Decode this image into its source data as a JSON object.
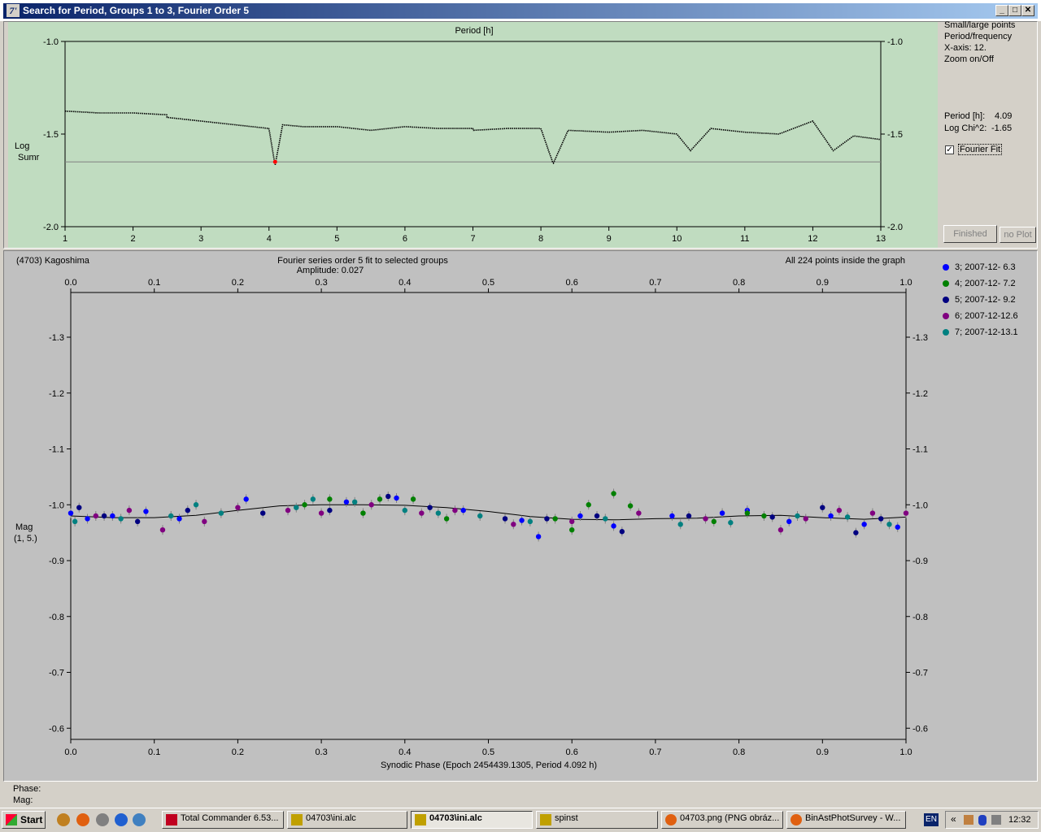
{
  "window": {
    "title": "Search for Period, Groups 1 to 3, Fourier Order 5",
    "app_icon": "7'",
    "controls": [
      "minimize",
      "maximize",
      "close"
    ]
  },
  "period_panel": {
    "options": [
      "Small/large points",
      "Period/frequency",
      "X-axis: 12.",
      "Zoom on/Off"
    ],
    "period_label": "Period [h]:",
    "period_value": "4.09",
    "chi_label": "Log Chi^2:",
    "chi_value": "-1.65",
    "fourier_fit_label": "Fourier Fit",
    "fourier_fit_checked": true,
    "finished_label": "Finished",
    "noplot_label": "no Plot"
  },
  "period_chart": {
    "title": "Period [h]",
    "ylabel_1": "Log",
    "ylabel_2": "Sumr",
    "x_ticks": [
      "1",
      "2",
      "3",
      "4",
      "5",
      "6",
      "7",
      "8",
      "9",
      "10",
      "11",
      "12",
      "13"
    ],
    "y_ticks_left": [
      "-1.0",
      "-1.5",
      "-2.0"
    ],
    "y_ticks_right": [
      "-1.0",
      "-1.5",
      "-2.0"
    ],
    "bg_color": "#c0dcc0"
  },
  "phase_panel": {
    "object": "(4703) Kagoshima",
    "fit_title": "Fourier series order 5 fit to selected groups",
    "amplitude": "Amplitude: 0.027",
    "points_info": "All 224 points inside the graph",
    "ylabel_1": "Mag",
    "ylabel_2": "(1, 5.)",
    "xlabel": "Synodic Phase (Epoch 2454439.1305, Period 4.092 h)",
    "x_ticks": [
      "0.0",
      "0.1",
      "0.2",
      "0.3",
      "0.4",
      "0.5",
      "0.6",
      "0.7",
      "0.8",
      "0.9",
      "1.0"
    ],
    "y_ticks": [
      "-1.3",
      "-1.2",
      "-1.1",
      "-1.0",
      "-0.9",
      "-0.8",
      "-0.7",
      "-0.6"
    ],
    "phase_label": "Phase:",
    "mag_label": "Mag:",
    "bg_color": "#c0c0c0"
  },
  "legend": [
    {
      "label": "3; 2007-12- 6.3",
      "color": "#0000ff"
    },
    {
      "label": "4; 2007-12- 7.2",
      "color": "#008000"
    },
    {
      "label": "5; 2007-12- 9.2",
      "color": "#000080"
    },
    {
      "label": "6; 2007-12-12.6",
      "color": "#800080"
    },
    {
      "label": "7; 2007-12-13.1",
      "color": "#008080"
    }
  ],
  "chart_data": [
    {
      "type": "scatter",
      "title": "Period [h]",
      "xlabel": "Period [h]",
      "ylabel": "Log Sumr",
      "xlim": [
        1,
        13
      ],
      "ylim": [
        -1.0,
        -2.0
      ],
      "best_period": 4.09,
      "best_value": -1.65,
      "threshold_line": -1.65,
      "x": [
        1.0,
        1.5,
        2.0,
        2.5,
        3.0,
        3.5,
        4.0,
        4.09,
        4.2,
        4.5,
        5.0,
        5.5,
        6.0,
        6.5,
        7.0,
        7.5,
        8.0,
        8.18,
        8.4,
        9.0,
        9.5,
        10.0,
        10.2,
        10.5,
        11.0,
        11.5,
        12.0,
        12.3,
        12.6,
        13.0
      ],
      "values": [
        -1.37,
        -1.38,
        -1.38,
        -1.39,
        -1.41,
        -1.43,
        -1.45,
        -1.65,
        -1.43,
        -1.44,
        -1.44,
        -1.46,
        -1.44,
        -1.45,
        -1.45,
        -1.44,
        -1.44,
        -1.63,
        -1.45,
        -1.46,
        -1.45,
        -1.47,
        -1.56,
        -1.44,
        -1.46,
        -1.47,
        -1.4,
        -1.56,
        -1.48,
        -1.5
      ]
    },
    {
      "type": "scatter",
      "title": "Fourier series order 5 fit to selected groups",
      "xlabel": "Synodic Phase (Epoch 2454439.1305, Period 4.092 h)",
      "ylabel": "Mag (1, 5.)",
      "xlim": [
        0.0,
        1.0
      ],
      "ylim": [
        -1.38,
        -0.58
      ],
      "fit": {
        "x": [
          0.0,
          0.05,
          0.1,
          0.15,
          0.2,
          0.25,
          0.3,
          0.35,
          0.4,
          0.45,
          0.5,
          0.55,
          0.6,
          0.65,
          0.7,
          0.75,
          0.8,
          0.85,
          0.9,
          0.95,
          1.0
        ],
        "y": [
          -0.98,
          -0.977,
          -0.977,
          -0.981,
          -0.99,
          -0.998,
          -1.0,
          -1.0,
          -0.999,
          -0.995,
          -0.988,
          -0.979,
          -0.974,
          -0.973,
          -0.975,
          -0.976,
          -0.98,
          -0.981,
          -0.977,
          -0.974,
          -0.978
        ]
      },
      "series": [
        {
          "name": "3; 2007-12- 6.3",
          "x": [
            0.0,
            0.02,
            0.05,
            0.09,
            0.13,
            0.21,
            0.33,
            0.39,
            0.47,
            0.54,
            0.56,
            0.61,
            0.65,
            0.72,
            0.78,
            0.81,
            0.86,
            0.91,
            0.95,
            0.99
          ],
          "y": [
            -0.985,
            -0.975,
            -0.98,
            -0.988,
            -0.975,
            -1.01,
            -1.005,
            -1.012,
            -0.99,
            -0.972,
            -0.943,
            -0.98,
            -0.962,
            -0.98,
            -0.985,
            -0.99,
            -0.97,
            -0.98,
            -0.965,
            -0.96
          ]
        },
        {
          "name": "4; 2007-12- 7.2",
          "x": [
            0.28,
            0.31,
            0.35,
            0.37,
            0.41,
            0.45,
            0.58,
            0.6,
            0.62,
            0.65,
            0.67,
            0.77,
            0.81,
            0.83
          ],
          "y": [
            -1.0,
            -1.01,
            -0.985,
            -1.01,
            -1.01,
            -0.975,
            -0.975,
            -0.955,
            -1.0,
            -1.02,
            -0.998,
            -0.97,
            -0.985,
            -0.98
          ]
        },
        {
          "name": "5; 2007-12- 9.2",
          "x": [
            0.01,
            0.04,
            0.08,
            0.14,
            0.23,
            0.31,
            0.38,
            0.43,
            0.52,
            0.57,
            0.63,
            0.66,
            0.74,
            0.84,
            0.9,
            0.94,
            0.97
          ],
          "y": [
            -0.995,
            -0.98,
            -0.97,
            -0.99,
            -0.985,
            -0.99,
            -1.015,
            -0.995,
            -0.975,
            -0.975,
            -0.98,
            -0.952,
            -0.98,
            -0.978,
            -0.995,
            -0.95,
            -0.975
          ]
        },
        {
          "name": "6; 2007-12-12.6",
          "x": [
            0.03,
            0.07,
            0.11,
            0.16,
            0.2,
            0.26,
            0.3,
            0.36,
            0.42,
            0.46,
            0.53,
            0.6,
            0.68,
            0.76,
            0.85,
            0.88,
            0.92,
            0.96,
            1.0
          ],
          "y": [
            -0.98,
            -0.99,
            -0.955,
            -0.97,
            -0.995,
            -0.99,
            -0.985,
            -1.0,
            -0.985,
            -0.99,
            -0.965,
            -0.97,
            -0.985,
            -0.975,
            -0.955,
            -0.975,
            -0.99,
            -0.985,
            -0.985
          ]
        },
        {
          "name": "7; 2007-12-13.1",
          "x": [
            0.005,
            0.06,
            0.12,
            0.15,
            0.18,
            0.27,
            0.29,
            0.34,
            0.4,
            0.44,
            0.49,
            0.55,
            0.64,
            0.73,
            0.79,
            0.87,
            0.93,
            0.98
          ],
          "y": [
            -0.97,
            -0.975,
            -0.98,
            -1.0,
            -0.985,
            -0.995,
            -1.01,
            -1.005,
            -0.99,
            -0.985,
            -0.98,
            -0.97,
            -0.975,
            -0.965,
            -0.968,
            -0.98,
            -0.978,
            -0.965
          ]
        }
      ]
    }
  ],
  "taskbar": {
    "start_label": "Start",
    "items": [
      {
        "label": "Total Commander 6.53...",
        "active": false
      },
      {
        "label": "04703\\ini.alc",
        "active": false
      },
      {
        "label": "04703\\ini.alc",
        "active": true
      },
      {
        "label": "spinst",
        "active": false
      },
      {
        "label": "04703.png (PNG obráz...",
        "active": false
      },
      {
        "label": "BinAstPhotSurvey - W...",
        "active": false
      }
    ],
    "lang": "EN",
    "tray_chevron": "«",
    "clock": "12:32"
  }
}
